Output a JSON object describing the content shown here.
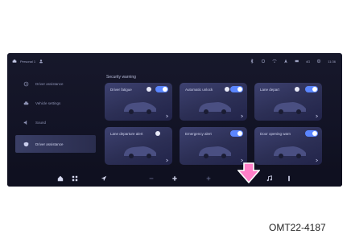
{
  "status_bar": {
    "profile": "Personal 1",
    "signal": "4G",
    "time": "11:36"
  },
  "sidebar": {
    "items": [
      {
        "label": "Driver assistance",
        "icon": "steering-icon",
        "active": false
      },
      {
        "label": "Vehicle settings",
        "icon": "car-icon",
        "active": false
      },
      {
        "label": "Sound",
        "icon": "speaker-icon",
        "active": false
      },
      {
        "label": "Driver assistance",
        "icon": "shield-icon",
        "active": true
      }
    ]
  },
  "section_title": "Security warning",
  "cards": [
    {
      "label": "Driver fatigue",
      "toggle_on": true
    },
    {
      "label": "Automatic unlock",
      "toggle_on": true
    },
    {
      "label": "Lane depart",
      "toggle_on": true
    },
    {
      "label": "Lane departure alert",
      "toggle_on": true
    },
    {
      "label": "Emergency alert",
      "toggle_on": true
    },
    {
      "label": "Door opening warn",
      "toggle_on": true
    }
  ],
  "caption": "OMT22-4187",
  "colors": {
    "accent": "#5b86ff",
    "arrow": "#ff7fc8",
    "bg": "#121325"
  }
}
